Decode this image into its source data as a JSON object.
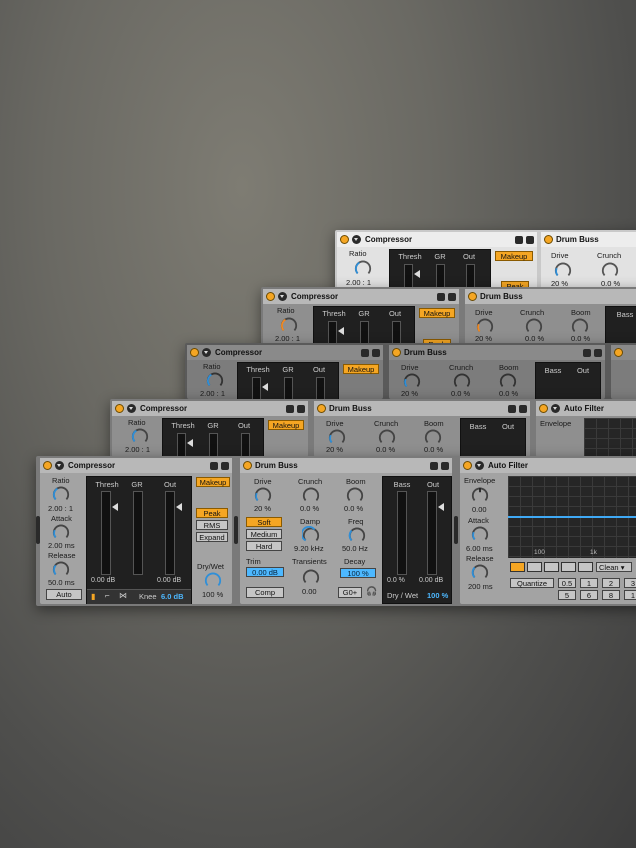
{
  "compressor": {
    "title": "Compressor",
    "ratio_label": "Ratio",
    "ratio_value": "2.00 : 1",
    "attack_label": "Attack",
    "attack_value": "2.00 ms",
    "release_label": "Release",
    "release_value": "50.0 ms",
    "auto_label": "Auto",
    "thresh_label": "Thresh",
    "gr_label": "GR",
    "out_label": "Out",
    "thresh_value": "0.00 dB",
    "out_value": "0.00 dB",
    "makeup_label": "Makeup",
    "peak_label": "Peak",
    "rms_label": "RMS",
    "expand_label": "Expand",
    "drywet_label": "Dry/Wet",
    "drywet_value": "100 %",
    "knee_label": "Knee",
    "knee_value": "6.0 dB"
  },
  "drum_buss": {
    "title": "Drum Buss",
    "drive_label": "Drive",
    "drive_value": "20 %",
    "crunch_label": "Crunch",
    "crunch_value": "0.0 %",
    "boom_label": "Boom",
    "boom_value": "0.0 %",
    "soft_label": "Soft",
    "medium_label": "Medium",
    "hard_label": "Hard",
    "damp_label": "Damp",
    "damp_value": "9.20 kHz",
    "freq_label": "Freq",
    "freq_value": "50.0 Hz",
    "trim_label": "Trim",
    "trim_value": "0.00 dB",
    "transients_label": "Transients",
    "transients_value": "0.00",
    "decay_label": "Decay",
    "decay_value": "100 %",
    "comp_label": "Comp",
    "go_label": "G0+",
    "bass_label": "Bass",
    "out_label": "Out",
    "bass_value": "0.0 %",
    "out_value": "0.00 dB",
    "drywet_label": "Dry / Wet",
    "drywet_value": "100 %"
  },
  "auto_filter": {
    "title": "Auto Filter",
    "envelope_label": "Envelope",
    "envelope_value": "0.00",
    "attack_label": "Attack",
    "attack_value": "6.00 ms",
    "release_label": "Release",
    "release_value": "200 ms",
    "freq_ticks": [
      "100",
      "1k"
    ],
    "mode_value": "Clean",
    "quantize_label": "Quantize",
    "quant_row1": [
      "0.5",
      "1",
      "2",
      "3"
    ],
    "quant_row2": [
      "5",
      "6",
      "8",
      "1"
    ]
  },
  "colors": {
    "accent": "#f5a623",
    "value_blue": "#4db8ff",
    "filter_curve": "#3fa9f5"
  }
}
